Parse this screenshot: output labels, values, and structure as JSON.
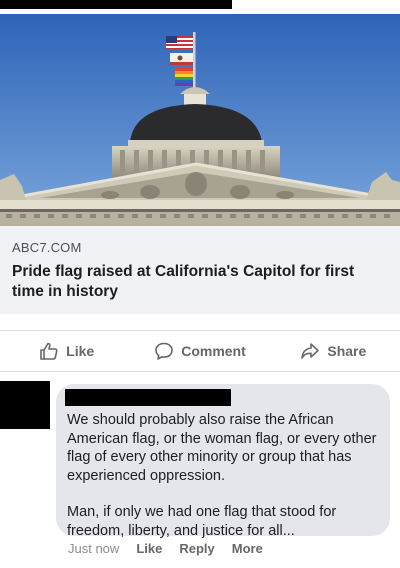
{
  "link_preview": {
    "domain": "ABC7.COM",
    "title": "Pride flag raised at California's Capitol for first time in history",
    "image_icon": "capitol-dome-with-flags-photo"
  },
  "actions": {
    "like_label": "Like",
    "comment_label": "Comment",
    "share_label": "Share",
    "like_icon": "thumbs-up-icon",
    "comment_icon": "speech-bubble-icon",
    "share_icon": "share-arrow-icon"
  },
  "comment": {
    "paragraph_1": "We should probably also raise the African American flag, or the woman flag, or every other flag of every other minority or group that has experienced oppression.",
    "paragraph_2": "Man, if only we had one flag that stood for freedom, liberty, and justice for all...",
    "timestamp": "Just now",
    "like_label": "Like",
    "reply_label": "Reply",
    "more_label": "More"
  },
  "colors": {
    "secondary_text": "#65676b",
    "bubble": "#e4e6eb",
    "card_bg": "#f0f2f5",
    "sky": "#3f78c9"
  }
}
